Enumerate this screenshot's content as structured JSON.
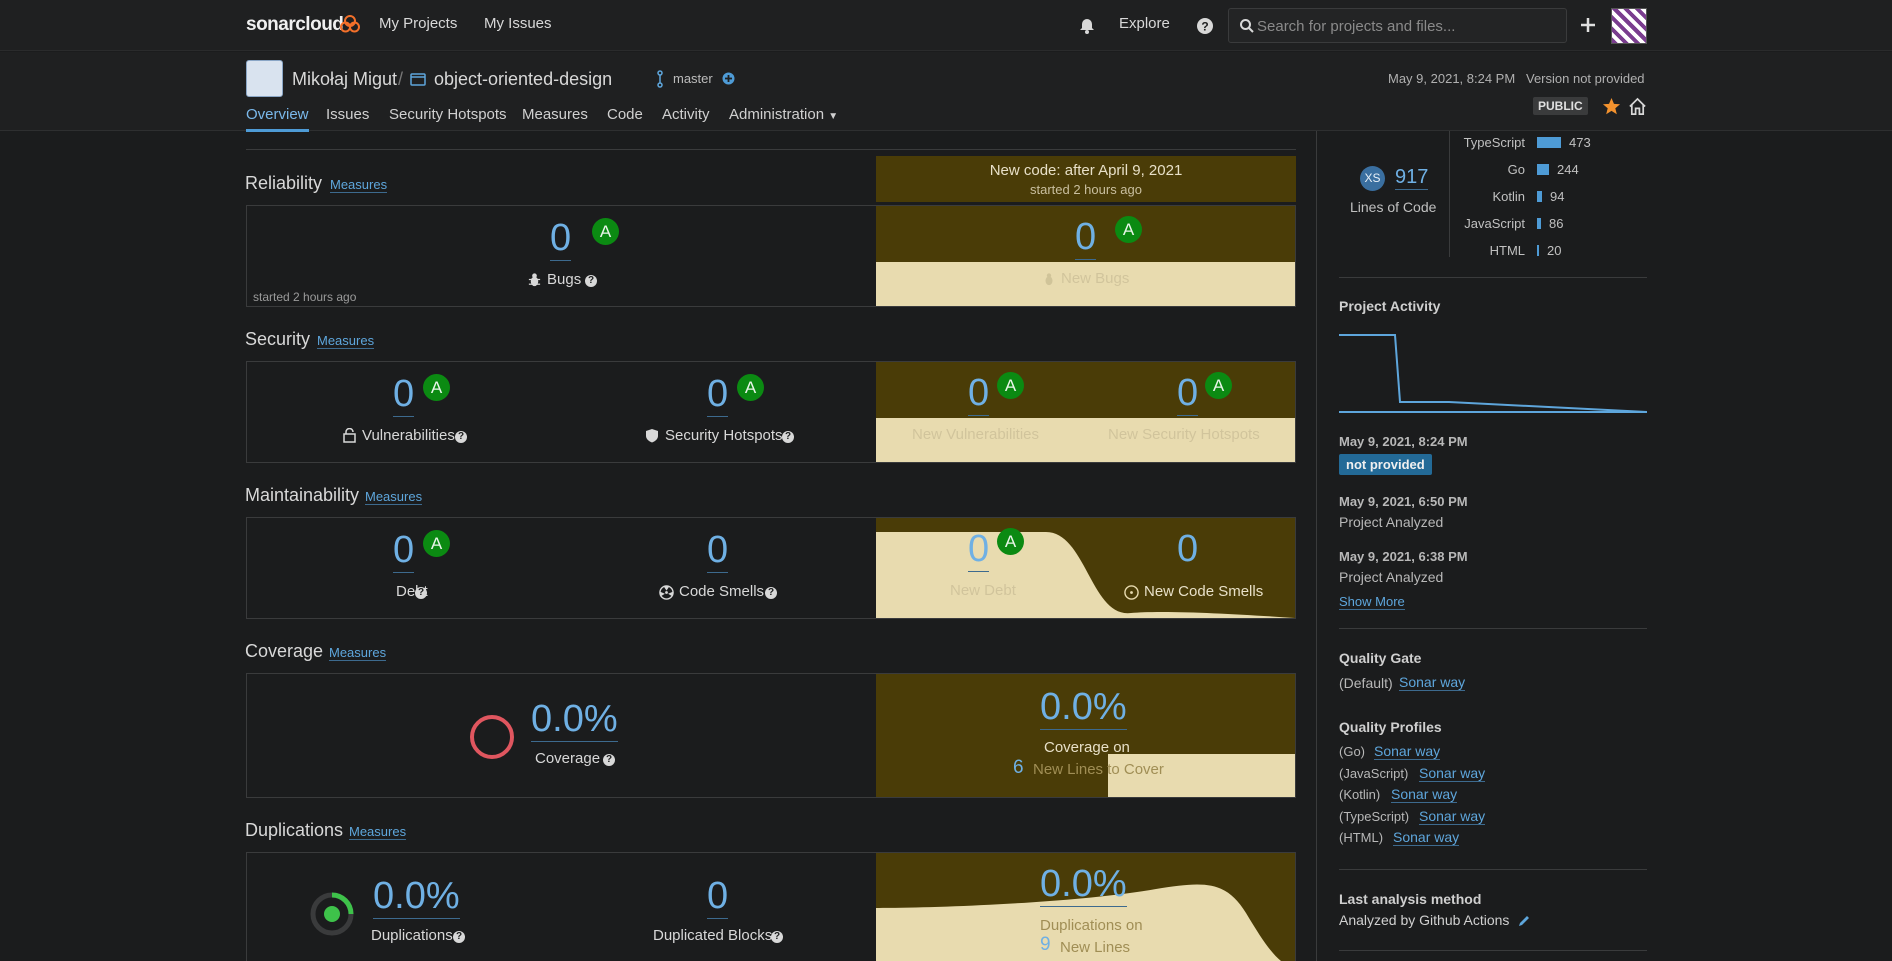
{
  "topnav": {
    "logo_text": "sonarcloud",
    "my_projects": "My Projects",
    "my_issues": "My Issues",
    "explore": "Explore",
    "search_placeholder": "Search for projects and files..."
  },
  "project": {
    "org": "Mikołaj Migut",
    "separator": "/",
    "name": "object-oriented-design",
    "branch": "master",
    "analysis_date": "May 9, 2021, 8:24 PM",
    "version": "Version not provided",
    "visibility": "PUBLIC"
  },
  "tabs": [
    "Overview",
    "Issues",
    "Security Hotspots",
    "Measures",
    "Code",
    "Activity",
    "Administration"
  ],
  "new_code": {
    "title": "New code: after April 9, 2021",
    "subtitle": "started 2 hours ago"
  },
  "measures_link": "Measures",
  "reliability": {
    "title": "Reliability",
    "bugs_value": "0",
    "bugs_rating": "A",
    "bugs_label": "Bugs",
    "started": "started 2 hours ago",
    "new_bugs_value": "0",
    "new_bugs_rating": "A",
    "new_bugs_label": "New Bugs"
  },
  "security": {
    "title": "Security",
    "vuln_value": "0",
    "vuln_rating": "A",
    "vuln_label": "Vulnerabilities",
    "hotspots_value": "0",
    "hotspots_rating": "A",
    "hotspots_label": "Security Hotspots",
    "new_vuln_value": "0",
    "new_vuln_rating": "A",
    "new_vuln_label": "New Vulnerabilities",
    "new_hotspots_value": "0",
    "new_hotspots_rating": "A",
    "new_hotspots_label": "New Security Hotspots"
  },
  "maintainability": {
    "title": "Maintainability",
    "debt_value": "0",
    "debt_rating": "A",
    "debt_label": "Debt",
    "smells_value": "0",
    "smells_label": "Code Smells",
    "new_debt_value": "0",
    "new_debt_rating": "A",
    "new_debt_label": "New Debt",
    "new_smells_value": "0",
    "new_smells_label": "New Code Smells"
  },
  "coverage": {
    "title": "Coverage",
    "value": "0.0%",
    "label": "Coverage",
    "new_value": "0.0%",
    "new_label": "Coverage on",
    "new_lines_value": "6",
    "new_lines_label": "New Lines to Cover"
  },
  "duplications": {
    "title": "Duplications",
    "value": "0.0%",
    "label": "Duplications",
    "blocks_value": "0",
    "blocks_label": "Duplicated Blocks",
    "new_value": "0.0%",
    "new_label": "Duplications on",
    "new_lines_value": "9",
    "new_lines_label": "New Lines"
  },
  "sidebar": {
    "size_badge": "XS",
    "loc_value": "917",
    "loc_label": "Lines of Code",
    "languages": [
      {
        "name": "TypeScript",
        "value": "473",
        "share": 0.516
      },
      {
        "name": "Go",
        "value": "244",
        "share": 0.266
      },
      {
        "name": "Kotlin",
        "value": "94",
        "share": 0.103
      },
      {
        "name": "JavaScript",
        "value": "86",
        "share": 0.094
      },
      {
        "name": "HTML",
        "value": "20",
        "share": 0.022
      }
    ],
    "activity_title": "Project Activity",
    "events": [
      {
        "date": "May 9, 2021, 8:24 PM",
        "badge": "not provided"
      },
      {
        "date": "May 9, 2021, 6:50 PM",
        "text": "Project Analyzed"
      },
      {
        "date": "May 9, 2021, 6:38 PM",
        "text": "Project Analyzed"
      }
    ],
    "show_more": "Show More",
    "qg_title": "Quality Gate",
    "qg_default": "(Default)",
    "qg_name": "Sonar way",
    "qp_title": "Quality Profiles",
    "profiles": [
      {
        "lang": "(Go)",
        "name": "Sonar way"
      },
      {
        "lang": "(JavaScript)",
        "name": "Sonar way"
      },
      {
        "lang": "(Kotlin)",
        "name": "Sonar way"
      },
      {
        "lang": "(TypeScript)",
        "name": "Sonar way"
      },
      {
        "lang": "(HTML)",
        "name": "Sonar way"
      }
    ],
    "analysis_title": "Last analysis method",
    "analysis_text": "Analyzed by Github Actions"
  },
  "colors": {
    "accent": "#4e9bd6",
    "rating_a": "#0b8a12",
    "new_code_bg": "#4a3c07",
    "new_code_light": "#e8dbaf",
    "coverage_ring": "#e0565f"
  }
}
